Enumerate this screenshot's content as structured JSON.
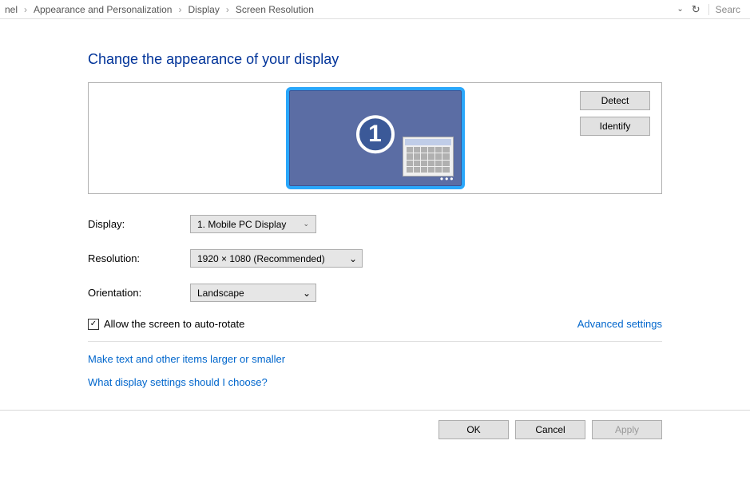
{
  "breadcrumb": {
    "item0": "nel",
    "item1": "Appearance and Personalization",
    "item2": "Display",
    "item3": "Screen Resolution"
  },
  "search": {
    "placeholder": "Searc"
  },
  "heading": "Change the appearance of your display",
  "panel": {
    "detect": "Detect",
    "identify": "Identify",
    "monitor_number": "1"
  },
  "form": {
    "display_label": "Display:",
    "display_value": "1. Mobile PC Display",
    "resolution_label": "Resolution:",
    "resolution_value": "1920 × 1080 (Recommended)",
    "orientation_label": "Orientation:",
    "orientation_value": "Landscape"
  },
  "autorotate": {
    "label": "Allow the screen to auto-rotate",
    "checked": "✓"
  },
  "links": {
    "advanced": "Advanced settings",
    "textsize": "Make text and other items larger or smaller",
    "help": "What display settings should I choose?"
  },
  "buttons": {
    "ok": "OK",
    "cancel": "Cancel",
    "apply": "Apply"
  }
}
